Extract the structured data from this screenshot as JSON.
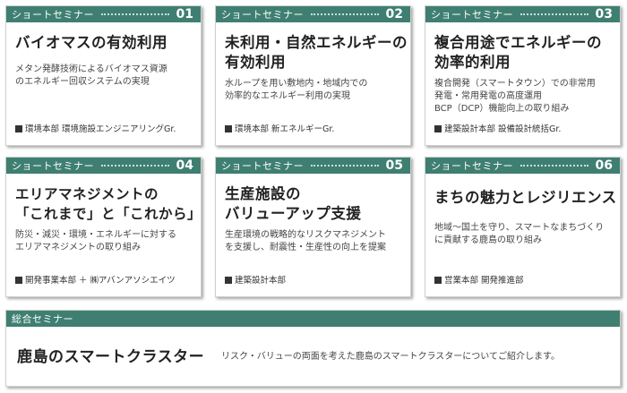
{
  "cards": [
    {
      "label": "ショートセミナー",
      "num": "01",
      "title_lines": [
        "バイオマスの有効利用"
      ],
      "desc_lines": [
        "メタン発酵技術によるバイオマス資源",
        "のエネルギー回収システムの実現"
      ],
      "dept": "環境本部 環境施設エンジニアリングGr."
    },
    {
      "label": "ショートセミナー",
      "num": "02",
      "title_lines": [
        "未利用・自然エネルギーの",
        "有効利用"
      ],
      "desc_lines": [
        "水ループを用い敷地内・地域内での",
        "効率的なエネルギー利用の実現"
      ],
      "dept": "環境本部 新エネルギーGr."
    },
    {
      "label": "ショートセミナー",
      "num": "03",
      "title_lines": [
        "複合用途でエネルギーの",
        "効率的利用"
      ],
      "desc_lines": [
        "複合開発（スマートタウン）での非常用",
        "発電・常用発電の高度運用",
        "BCP（DCP）機能向上の取り組み"
      ],
      "dept": "建築設計本部 設備設計統括Gr."
    },
    {
      "label": "ショートセミナー",
      "num": "04",
      "title_lines": [
        "エリアマネジメントの",
        "「これまで」と「これから」"
      ],
      "desc_lines": [
        "防災・減災・環境・エネルギーに対する",
        "エリアマネジメントの取り組み"
      ],
      "dept": "開発事業本部 ＋ ㈱アバンアソシエイツ"
    },
    {
      "label": "ショートセミナー",
      "num": "05",
      "title_lines": [
        "生産施設の",
        "バリューアップ支援"
      ],
      "desc_lines": [
        "生産環境の戦略的なリスクマネジメント",
        "を支援し、耐震性・生産性の向上を提案"
      ],
      "dept": "建築設計本部"
    },
    {
      "label": "ショートセミナー",
      "num": "06",
      "title_lines": [
        "まちの魅力とレジリエンス"
      ],
      "desc_lines": [
        "地域～国土を守り、スマートなまちづくり",
        "に貢献する鹿島の取り組み"
      ],
      "dept": "営業本部 開発推進部"
    }
  ],
  "general": {
    "label": "総合セミナー",
    "title": "鹿島のスマートクラスター",
    "desc": "リスク・バリューの両面を考えた鹿島のスマートクラスターについてご紹介します。"
  }
}
